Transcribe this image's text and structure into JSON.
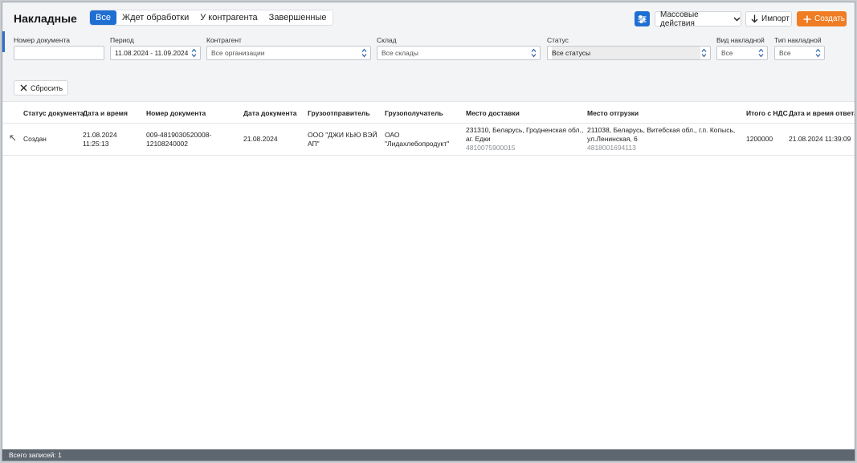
{
  "header": {
    "title": "Накладные"
  },
  "tabs": [
    {
      "label": "Все",
      "active": true
    },
    {
      "label": "Ждет обработки",
      "active": false
    },
    {
      "label": "У контрагента",
      "active": false
    },
    {
      "label": "Завершенные",
      "active": false
    }
  ],
  "toolbar": {
    "settings_icon": "sliders-icon",
    "mass_actions_label": "Массовые действия",
    "import_label": "Импорт",
    "create_label": "Создать"
  },
  "filters": {
    "doc_number": {
      "label": "Номер документа",
      "value": ""
    },
    "period": {
      "label": "Период",
      "value": "11.08.2024 - 11.09.2024"
    },
    "counterparty": {
      "label": "Контрагент",
      "value": "Все организации"
    },
    "warehouse": {
      "label": "Склад",
      "value": "Все склады"
    },
    "status": {
      "label": "Статус",
      "value": "Все статусы"
    },
    "invoice_kind": {
      "label": "Вид накладной",
      "value": "Все"
    },
    "invoice_type": {
      "label": "Тип накладной",
      "value": "Все"
    },
    "reset_label": "Сбросить"
  },
  "table": {
    "columns": [
      "Статус документа",
      "Дата и время",
      "Номер документа",
      "Дата документа",
      "Грузоотправитель",
      "Грузополучатель",
      "Место доставки",
      "Место отгрузки",
      "Итого с НДС",
      "Дата и время ответа"
    ],
    "rows": [
      {
        "status": "Создан",
        "datetime_line1": "21.08.2024",
        "datetime_line2": "11:25:13",
        "doc_number_line1": "009-4819030520008-",
        "doc_number_line2": "12108240002",
        "doc_date": "21.08.2024",
        "shipper_line1": "ООО \"ДЖИ КЬЮ ВЭЙ",
        "shipper_line2": "АП\"",
        "consignee_line1": "ОАО",
        "consignee_line2": "\"Лидахлебопродукт\"",
        "delivery_line1": "231310, Беларусь, Гродненская обл.,",
        "delivery_line2": "аг. Едки",
        "delivery_code": "4810075900015",
        "shipment_line1": "211038, Беларусь, Витебская обл., г.п. Копысь,",
        "shipment_line2": "ул.Ленинская, 6",
        "shipment_code": "4818001694113",
        "total": "1200000",
        "response_datetime": "21.08.2024 11:39:09"
      }
    ]
  },
  "footer": {
    "total_records": "Всего записей: 1"
  }
}
